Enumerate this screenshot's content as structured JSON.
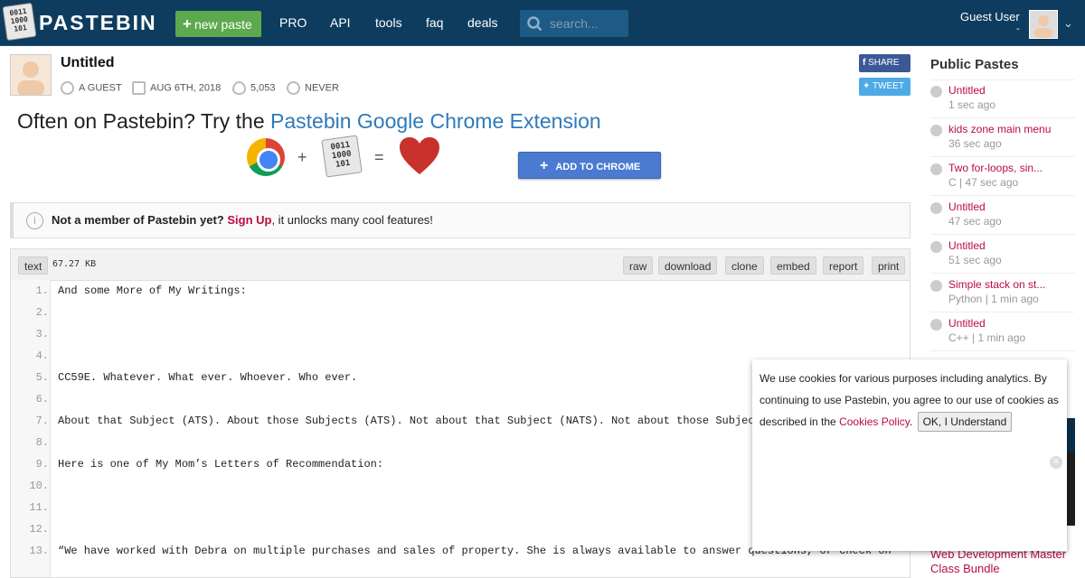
{
  "header": {
    "brand": "PASTEBIN",
    "logo_digits": "0011\n1000\n101",
    "new_paste": "new paste",
    "nav": [
      "PRO",
      "API",
      "tools",
      "faq",
      "deals"
    ],
    "search_placeholder": "search...",
    "user_name": "Guest User",
    "user_sub": "-"
  },
  "paste": {
    "title": "Untitled",
    "author": "A GUEST",
    "date": "AUG 6TH, 2018",
    "views": "5,053",
    "expiry": "NEVER",
    "share": "SHARE",
    "tweet": "TWEET"
  },
  "promo": {
    "lead": "Often on Pastebin? Try the ",
    "link": "Pastebin Google Chrome Extension",
    "plus": "+",
    "equals": "=",
    "add_button": "ADD TO CHROME"
  },
  "notice": {
    "lead": "Not a member of Pastebin yet?",
    "link": "Sign Up",
    "rest": ", it unlocks many cool features!"
  },
  "code_toolbar": {
    "syntax": "text",
    "size": "67.27 KB",
    "actions": [
      "raw",
      "download",
      "clone",
      "embed",
      "report",
      "print"
    ]
  },
  "code_lines": [
    {
      "n": "1.",
      "t": "And some More of My Writings:"
    },
    {
      "n": "2.",
      "t": ""
    },
    {
      "n": "3.",
      "t": ""
    },
    {
      "n": "4.",
      "t": ""
    },
    {
      "n": "5.",
      "t": "CC59E. Whatever. What ever. Whoever. Who ever."
    },
    {
      "n": "6.",
      "t": ""
    },
    {
      "n": "7.",
      "t": "About that Subject (ATS). About those Subjects (ATS). Not about that Subject (NATS). Not about those Subjects"
    },
    {
      "n": "8.",
      "t": ""
    },
    {
      "n": "9.",
      "t": "Here is one of My Mom’s Letters of Recommendation:"
    },
    {
      "n": "10.",
      "t": ""
    },
    {
      "n": "11.",
      "t": ""
    },
    {
      "n": "12.",
      "t": ""
    },
    {
      "n": "13.",
      "t": "“We have worked with Debra on multiple purchases and sales of property. She is always available to answer questions, or check on"
    }
  ],
  "sidebar": {
    "heading": "Public Pastes",
    "items": [
      {
        "title": "Untitled",
        "sub": "1 sec ago"
      },
      {
        "title": "kids zone main menu",
        "sub": "36 sec ago"
      },
      {
        "title": "Two for-loops, sin...",
        "sub": "C | 47 sec ago"
      },
      {
        "title": "Untitled",
        "sub": "47 sec ago"
      },
      {
        "title": "Untitled",
        "sub": "51 sec ago"
      },
      {
        "title": "Simple stack on st...",
        "sub": "Python | 1 min ago"
      },
      {
        "title": "Untitled",
        "sub": "C++ | 1 min ago"
      }
    ],
    "ad_text": "Web Development Master Class Bundle"
  },
  "cookie": {
    "text": "We use cookies for various purposes including analytics. By continuing to use Pastebin, you agree to our use of cookies as described in the ",
    "link": "Cookies Policy",
    "after": ".",
    "ok": "OK, I Understand"
  }
}
